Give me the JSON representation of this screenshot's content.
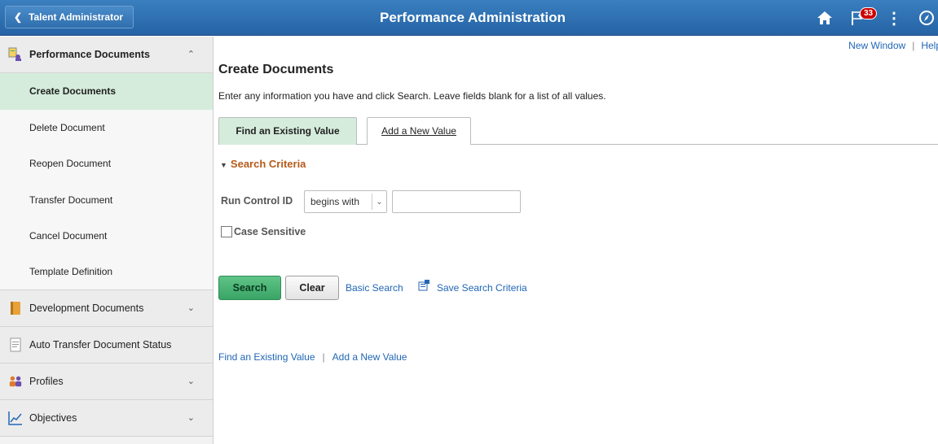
{
  "header": {
    "back_label": "Talent Administrator",
    "title": "Performance Administration",
    "notification_count": "33"
  },
  "sidebar": {
    "groups": [
      {
        "label": "Performance Documents",
        "expanded": true,
        "icon": "performance-docs-icon"
      },
      {
        "label": "Development Documents",
        "expanded": false,
        "icon": "book-icon"
      },
      {
        "label": "Auto Transfer Document Status",
        "expanded": false,
        "icon": "document-icon"
      },
      {
        "label": "Profiles",
        "expanded": false,
        "icon": "people-icon"
      },
      {
        "label": "Objectives",
        "expanded": false,
        "icon": "line-chart-icon"
      }
    ],
    "items": [
      {
        "label": "Create Documents",
        "active": true
      },
      {
        "label": "Delete Document"
      },
      {
        "label": "Reopen Document"
      },
      {
        "label": "Transfer Document"
      },
      {
        "label": "Cancel Document"
      },
      {
        "label": "Template Definition"
      }
    ]
  },
  "toplinks": {
    "new_window": "New Window",
    "help": "Help"
  },
  "main": {
    "title": "Create Documents",
    "instructions": "Enter any information you have and click Search. Leave fields blank for a list of all values.",
    "tabs": [
      {
        "label": "Find an Existing Value",
        "active": true
      },
      {
        "label": "Add a New Value",
        "active": false
      }
    ],
    "search_criteria_label": "Search Criteria",
    "run_control_label": "Run Control ID",
    "operator_value": "begins with",
    "run_control_value": "",
    "case_sensitive_label": "Case Sensitive",
    "search_button": "Search",
    "clear_button": "Clear",
    "basic_search": "Basic Search",
    "save_search": "Save Search Criteria",
    "bottom_links": {
      "find": "Find an Existing Value",
      "add": "Add a New Value"
    }
  },
  "colors": {
    "header": "#2d6eb0",
    "active_green": "#d5ecdc",
    "search_button": "#4cb677",
    "link": "#2166b5",
    "criteria_title": "#b55a1a",
    "badge": "#cc0000"
  }
}
